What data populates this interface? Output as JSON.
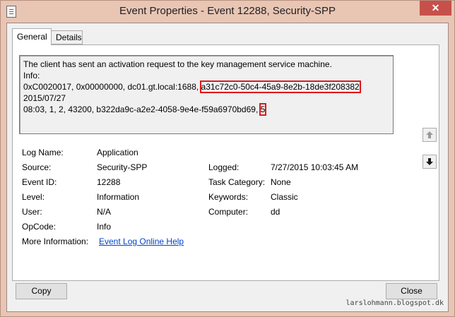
{
  "window": {
    "title": "Event Properties - Event 12288, Security-SPP",
    "close_glyph": "✕"
  },
  "tabs": [
    {
      "label": "General",
      "selected": true
    },
    {
      "label": "Details",
      "selected": false
    }
  ],
  "description": {
    "line1": "The client has sent an activation request to the key management service machine.",
    "line2": "Info:",
    "line3_pre": "0xC0020017, 0x00000000, dc01.gt.local:1688, ",
    "line3_guid": "a31c72c0-50c4-45a9-8e2b-18de3f208382",
    "line3_post": ", 2015/07/27",
    "line4_pre": "08:03, 1, 2, 43200, b322da9c-a2e2-4058-9e4e-f59a6970bd69, ",
    "line4_hl": "5"
  },
  "fields": {
    "log_name_label": "Log Name:",
    "log_name": "Application",
    "source_label": "Source:",
    "source": "Security-SPP",
    "logged_label": "Logged:",
    "logged": "7/27/2015 10:03:45 AM",
    "event_id_label": "Event ID:",
    "event_id": "12288",
    "task_category_label": "Task Category:",
    "task_category": "None",
    "level_label": "Level:",
    "level": "Information",
    "keywords_label": "Keywords:",
    "keywords": "Classic",
    "user_label": "User:",
    "user": "N/A",
    "computer_label": "Computer:",
    "computer": "dd",
    "opcode_label": "OpCode:",
    "opcode": "Info",
    "more_info_label": "More Information:",
    "more_info_link": "Event Log Online Help"
  },
  "buttons": {
    "copy": "Copy",
    "close": "Close"
  },
  "watermark": "larslohmann.blogspot.dk",
  "colors": {
    "title_bar": "#e9c5b4",
    "close_button": "#c7504a",
    "highlight_box": "#e01818",
    "link": "#0044cc"
  },
  "icons": {
    "scroll_up": "up-arrow-icon",
    "scroll_down": "down-arrow-icon"
  }
}
